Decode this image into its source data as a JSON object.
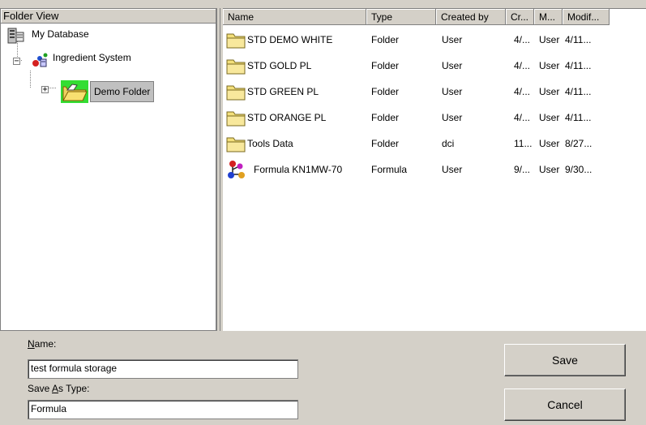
{
  "tree": {
    "header": "Folder View",
    "nodes": [
      {
        "label": "My Database",
        "icon": "database-icon"
      },
      {
        "label": "Ingredient System",
        "icon": "ingredient-system-icon",
        "expander": "−"
      },
      {
        "label": "Demo Folder",
        "icon": "open-folder-icon",
        "expander": "+",
        "selected": true
      }
    ]
  },
  "list": {
    "columns": [
      "Name",
      "Type",
      "Created by",
      "Cr...",
      "M...",
      "Modif..."
    ],
    "rows": [
      {
        "name": "STD DEMO WHITE",
        "type": "Folder",
        "created_by": "User",
        "created": "4/...",
        "modified_by": "User",
        "modified": "4/11...",
        "icon": "folder-icon"
      },
      {
        "name": "STD GOLD PL",
        "type": "Folder",
        "created_by": "User",
        "created": "4/...",
        "modified_by": "User",
        "modified": "4/11...",
        "icon": "folder-icon"
      },
      {
        "name": "STD GREEN PL",
        "type": "Folder",
        "created_by": "User",
        "created": "4/...",
        "modified_by": "User",
        "modified": "4/11...",
        "icon": "folder-icon"
      },
      {
        "name": "STD ORANGE PL",
        "type": "Folder",
        "created_by": "User",
        "created": "4/...",
        "modified_by": "User",
        "modified": "4/11...",
        "icon": "folder-icon"
      },
      {
        "name": "Tools Data",
        "type": "Folder",
        "created_by": "dci",
        "created": "11...",
        "modified_by": "User",
        "modified": "8/27...",
        "icon": "folder-icon"
      },
      {
        "name": "Formula KN1MW-70",
        "type": "Formula",
        "created_by": "User",
        "created": "9/...",
        "modified_by": "User",
        "modified": "9/30...",
        "icon": "formula-molecule-icon"
      }
    ]
  },
  "form": {
    "name_label_prefix": "",
    "name_label_mnemonic": "N",
    "name_label_rest": "ame:",
    "name_value": "test formula storage",
    "type_label_prefix": "Save ",
    "type_label_mnemonic": "A",
    "type_label_rest": "s Type:",
    "type_value": "Formula",
    "save_label": "Save",
    "cancel_label": "Cancel"
  }
}
